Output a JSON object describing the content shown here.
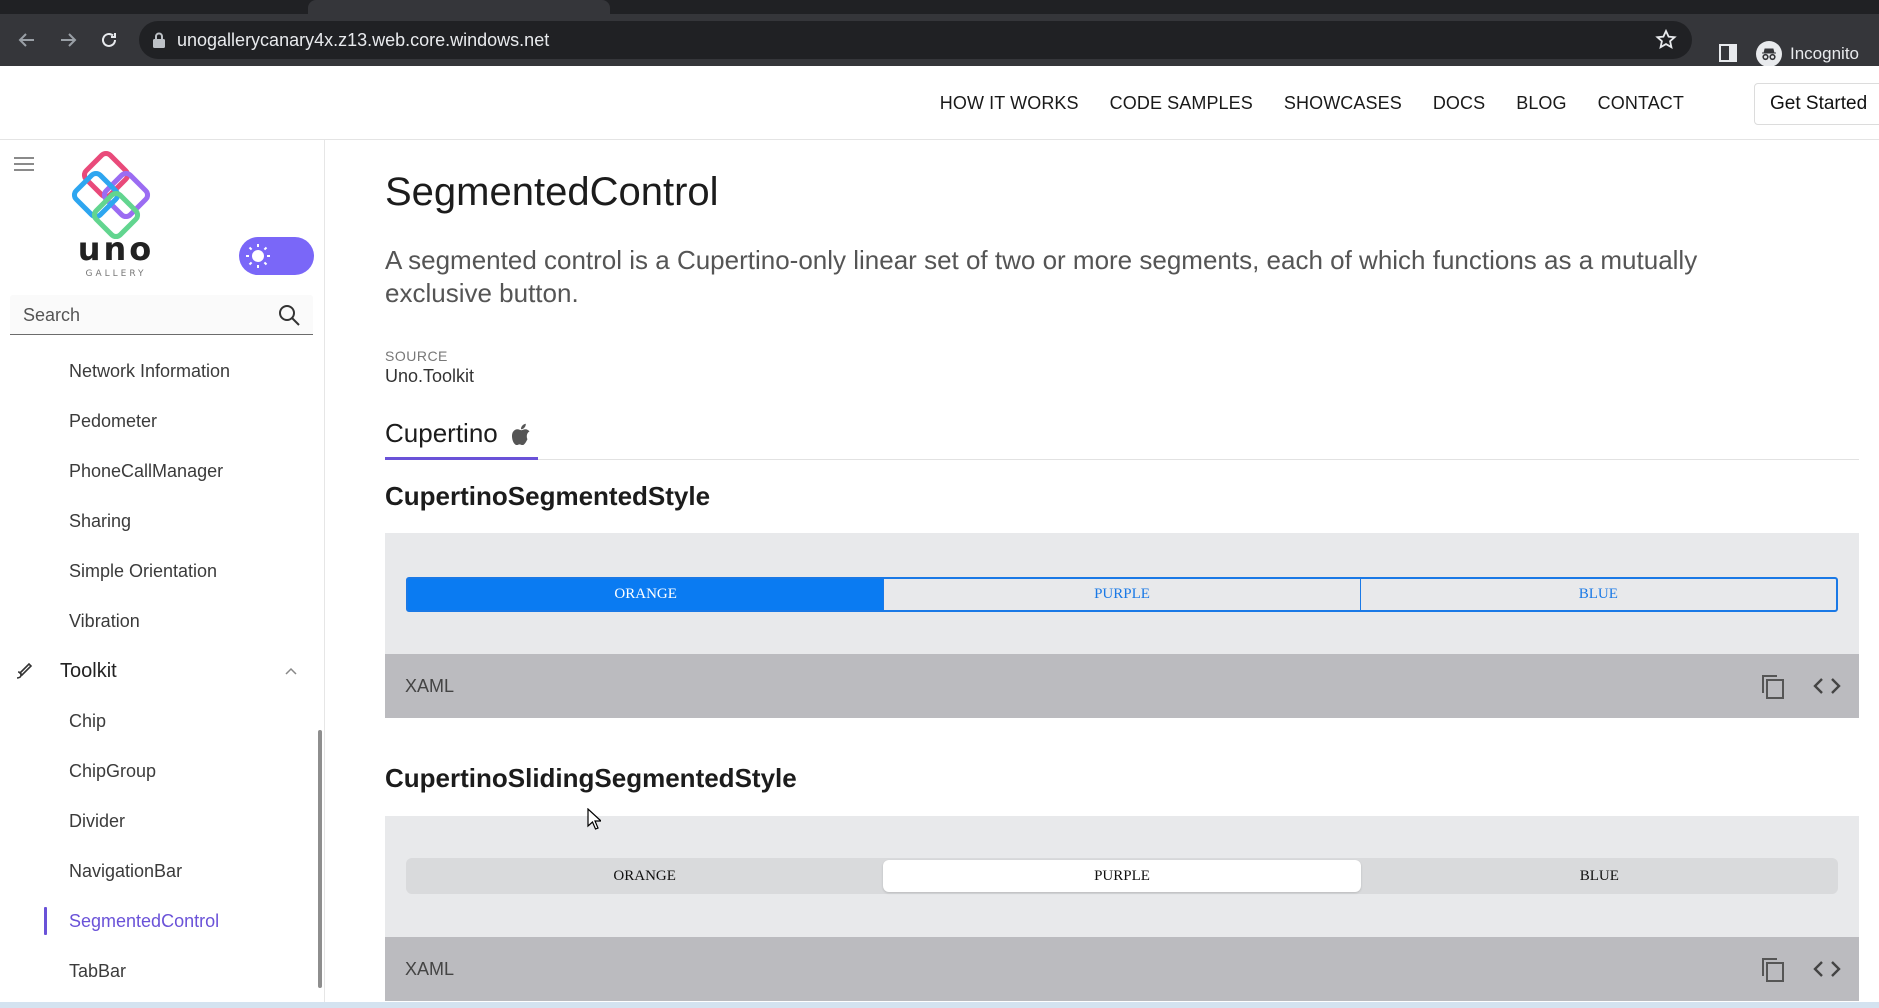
{
  "browser": {
    "url": "unogallerycanary4x.z13.web.core.windows.net",
    "profile_label": "Incognito",
    "tab_color": "#35363a"
  },
  "site_header": {
    "nav": [
      "HOW IT WORKS",
      "CODE SAMPLES",
      "SHOWCASES",
      "DOCS",
      "BLOG",
      "CONTACT"
    ],
    "cta": "Get Started"
  },
  "sidebar": {
    "logo_text": "uno",
    "logo_sub": "GALLERY",
    "search_placeholder": "Search",
    "items_before": [
      "Network Information",
      "Pedometer",
      "PhoneCallManager",
      "Sharing",
      "Simple Orientation",
      "Vibration"
    ],
    "group_label": "Toolkit",
    "items_after": [
      "Chip",
      "ChipGroup",
      "Divider",
      "NavigationBar",
      "SegmentedControl",
      "TabBar"
    ],
    "selected_item": "SegmentedControl",
    "accent": "#6a52d8",
    "toggle_color": "#7a67f8"
  },
  "main": {
    "title": "SegmentedControl",
    "description": "A segmented control is a Cupertino-only linear set of two or more segments, each of which functions as a mutually exclusive button.",
    "source_label": "SOURCE",
    "source_value": "Uno.Toolkit",
    "tab_label": "Cupertino",
    "sections": [
      {
        "title": "CupertinoSegmentedStyle",
        "segments": [
          "ORANGE",
          "PURPLE",
          "BLUE"
        ],
        "selected_index": 0,
        "code_label": "XAML",
        "accent": "#0a7bf2"
      },
      {
        "title": "CupertinoSlidingSegmentedStyle",
        "segments": [
          "ORANGE",
          "PURPLE",
          "BLUE"
        ],
        "selected_index": 1,
        "code_label": "XAML"
      }
    ]
  }
}
